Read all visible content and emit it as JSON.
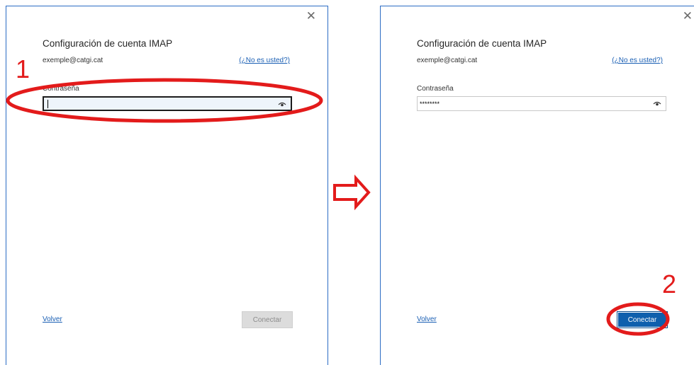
{
  "step1": {
    "title": "Configuración de cuenta IMAP",
    "email": "exemple@catgi.cat",
    "not_you": "(¿No es usted?)",
    "password_label": "Contraseña",
    "password_value": "",
    "back_label": "Volver",
    "connect_label": "Conectar",
    "close_symbol": "✕"
  },
  "step2": {
    "title": "Configuración de cuenta IMAP",
    "email": "exemple@catgi.cat",
    "not_you": "(¿No es usted?)",
    "password_label": "Contraseña",
    "password_value": "********",
    "back_label": "Volver",
    "connect_label": "Conectar",
    "close_symbol": "✕"
  },
  "annotations": {
    "step1_number": "1",
    "step2_number": "2",
    "color": "#e31b1b"
  },
  "icons": [
    "close-icon",
    "eye-icon",
    "arrow-right-icon"
  ]
}
